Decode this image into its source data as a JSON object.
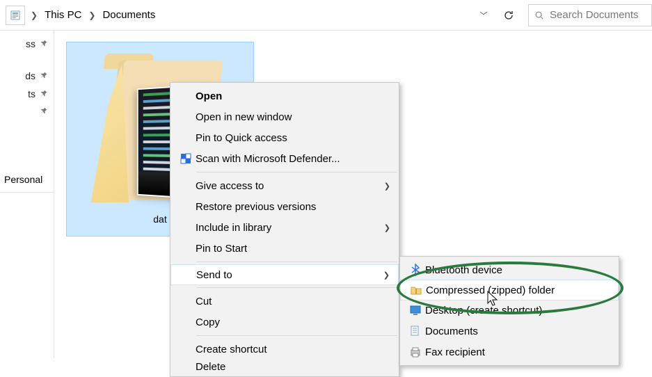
{
  "breadcrumbs": {
    "pc": "This PC",
    "docs": "Documents"
  },
  "search": {
    "placeholder": "Search Documents"
  },
  "sidebar": {
    "items": [
      {
        "label": "ss"
      },
      {
        "label": "ds"
      },
      {
        "label": "ts"
      }
    ],
    "section": "Personal"
  },
  "folder": {
    "name": "dat"
  },
  "context_menu": {
    "open": "Open",
    "open_new_window": "Open in new window",
    "pin_quick_access": "Pin to Quick access",
    "scan_defender": "Scan with Microsoft Defender...",
    "give_access": "Give access to",
    "restore_versions": "Restore previous versions",
    "include_library": "Include in library",
    "pin_start": "Pin to Start",
    "send_to": "Send to",
    "cut": "Cut",
    "copy": "Copy",
    "create_shortcut": "Create shortcut",
    "delete": "Delete"
  },
  "send_to_menu": {
    "bluetooth": "Bluetooth device",
    "compressed": "Compressed (zipped) folder",
    "desktop_shortcut": "Desktop (create shortcut)",
    "documents": "Documents",
    "fax": "Fax recipient"
  }
}
